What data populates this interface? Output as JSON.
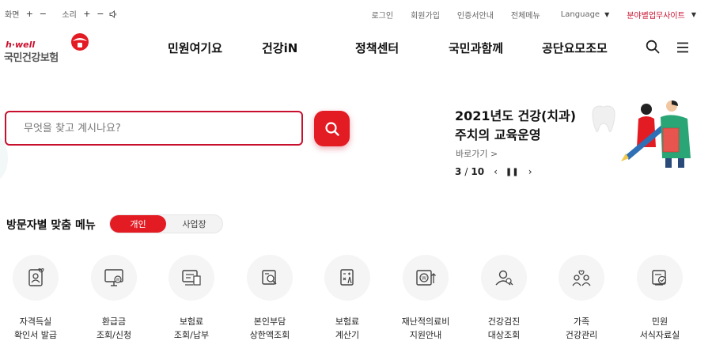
{
  "util": {
    "screen_label": "화면",
    "sound_label": "소리",
    "plus": "+",
    "minus": "−",
    "links": [
      "로그인",
      "회원가입",
      "인증서안내",
      "전체메뉴"
    ],
    "language": "Language",
    "site_select": "분야별업무사이트"
  },
  "header": {
    "logo_top": "h·well",
    "logo_name": "국민건강보험",
    "nav": [
      "민원여기요",
      "건강iN",
      "정책센터",
      "국민과함께",
      "공단요모조모"
    ],
    "search_icon": "search-icon",
    "menu_icon": "hamburger-menu-icon"
  },
  "search": {
    "placeholder": "무엇을 찾고 계시나요?"
  },
  "banner": {
    "title_line1": "2021년도 건강(치과)",
    "title_line2": "주치의 교육운영",
    "link": "바로가기 >",
    "current": "3",
    "sep": "/",
    "total": "10",
    "prev": "‹",
    "pause": "❚❚",
    "next": "›"
  },
  "visitor_menu": {
    "title": "방문자별 맞춤 메뉴",
    "tabs": [
      "개인",
      "사업장"
    ],
    "active_tab": 0,
    "items": [
      {
        "line1": "자격득실",
        "line2": "확인서 발급",
        "icon": "certificate-icon"
      },
      {
        "line1": "환급금",
        "line2": "조회/신청",
        "icon": "monitor-won-icon"
      },
      {
        "line1": "보험료",
        "line2": "조회/납부",
        "icon": "bill-icon"
      },
      {
        "line1": "본인부담",
        "line2": "상한액조회",
        "icon": "document-search-icon"
      },
      {
        "line1": "보험료",
        "line2": "계산기",
        "icon": "calculator-icon"
      },
      {
        "line1": "재난적의료비",
        "line2": "지원안내",
        "icon": "won-up-icon"
      },
      {
        "line1": "건강검진",
        "line2": "대상조회",
        "icon": "people-search-icon"
      },
      {
        "line1": "가족",
        "line2": "건강관리",
        "icon": "family-heart-icon"
      },
      {
        "line1": "민원",
        "line2": "서식자료실",
        "icon": "form-check-icon"
      }
    ]
  },
  "colors": {
    "brand_red": "#e31b23",
    "border_red": "#c8102e"
  }
}
